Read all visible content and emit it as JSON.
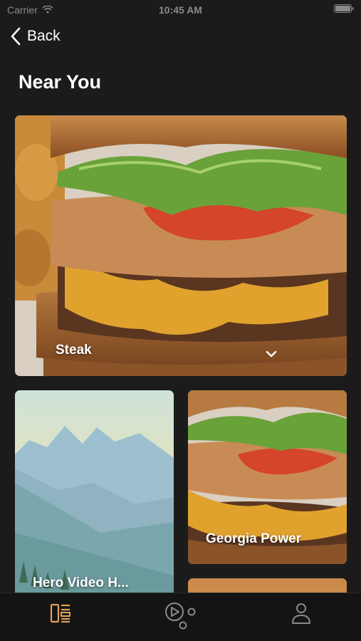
{
  "status_bar": {
    "carrier": "Carrier",
    "time": "10:45 AM"
  },
  "nav": {
    "back_label": "Back"
  },
  "page": {
    "title": "Near You"
  },
  "cards": [
    {
      "label": "Steak"
    },
    {
      "label": "Hero Video H..."
    },
    {
      "label": "Georgia Power"
    }
  ],
  "tab_bar": {
    "tabs": [
      {
        "icon": "feed-icon",
        "active": true
      },
      {
        "icon": "media-icon",
        "active": false
      },
      {
        "icon": "profile-icon",
        "active": false
      }
    ],
    "active_color": "#e0a15a",
    "inactive_color": "#8a8a8a"
  }
}
